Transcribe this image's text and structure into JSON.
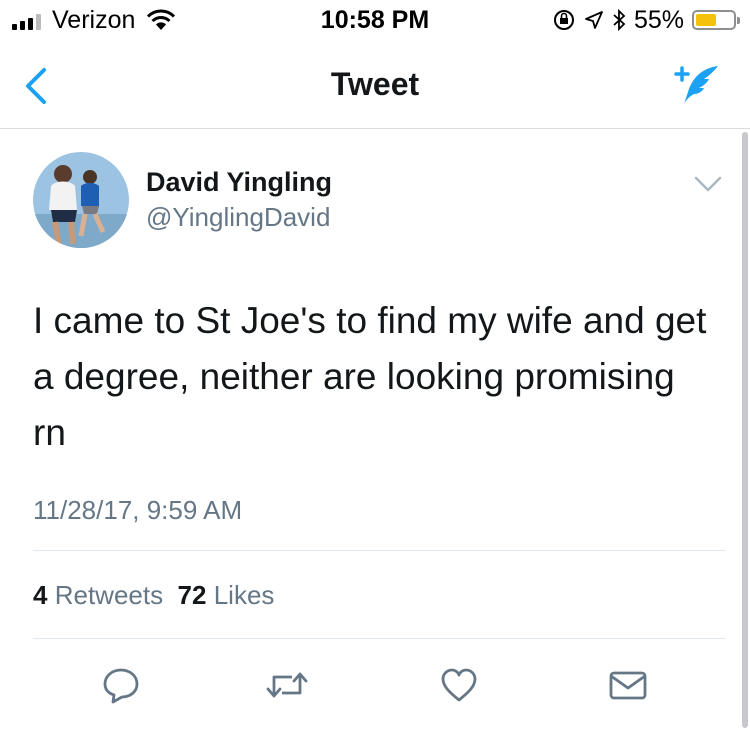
{
  "status_bar": {
    "carrier": "Verizon",
    "time": "10:58 PM",
    "battery_percent": "55%",
    "battery_level": 0.55,
    "battery_color": "#f4c20d"
  },
  "nav": {
    "title": "Tweet",
    "back_icon": "chevron-left-icon",
    "compose_icon": "compose-tweet-icon",
    "accent_color": "#1da1f2"
  },
  "tweet": {
    "author_name": "David Yingling",
    "author_handle": "@YinglingDavid",
    "text": "I came to St Joe's to find my wife and get a degree, neither are looking promising rn",
    "timestamp": "11/28/17, 9:59 AM",
    "retweets_count": "4",
    "retweets_label": "Retweets",
    "likes_count": "72",
    "likes_label": "Likes"
  },
  "actions": [
    {
      "icon": "reply-icon"
    },
    {
      "icon": "retweet-icon"
    },
    {
      "icon": "like-icon"
    },
    {
      "icon": "share-mail-icon"
    }
  ]
}
